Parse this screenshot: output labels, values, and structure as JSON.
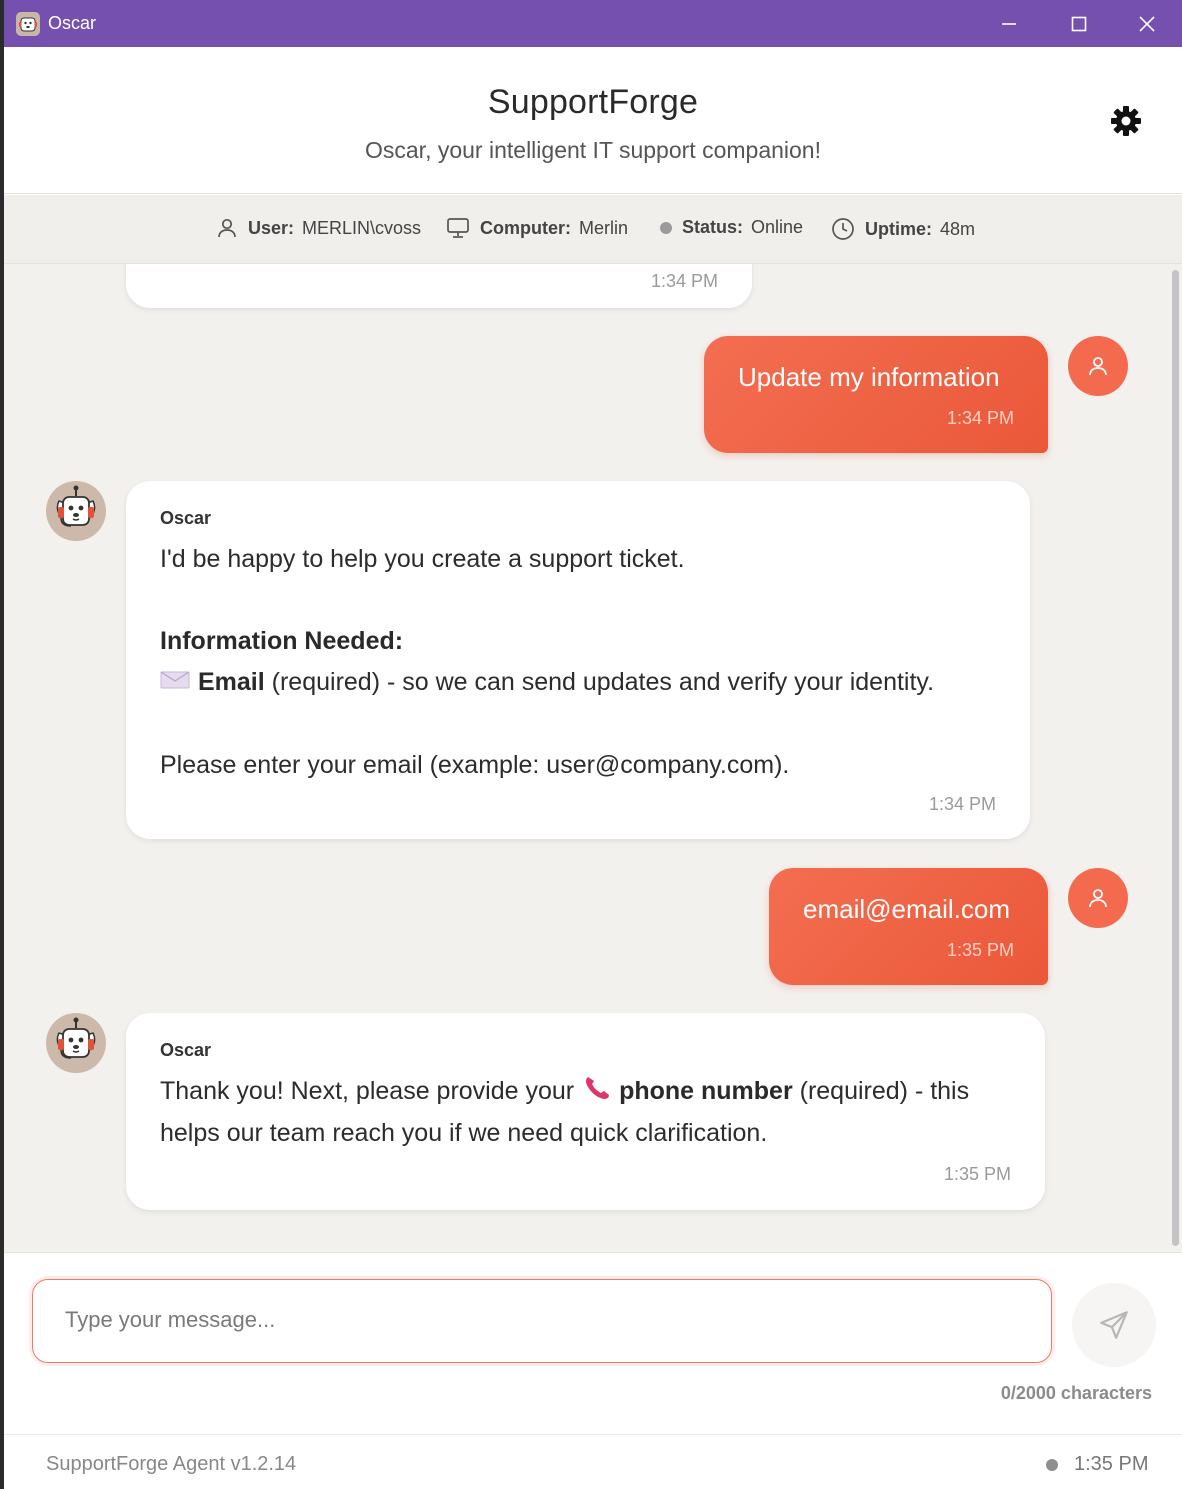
{
  "window": {
    "title": "Oscar",
    "accent": "#7650ae",
    "controls": [
      "minimize-icon",
      "maximize-icon",
      "close-icon"
    ]
  },
  "header": {
    "brand": "SupportForge",
    "tagline": "Oscar, your intelligent IT support companion!",
    "settings_icon": "gear-icon"
  },
  "info": {
    "user_label": "User:",
    "user_value": "MERLIN\\cvoss",
    "computer_label": "Computer:",
    "computer_value": "Merlin",
    "status_label": "Status:",
    "status_value": "Online",
    "uptime_label": "Uptime:",
    "uptime_value": "48m"
  },
  "messages": [
    {
      "from": "bot",
      "time": "1:34 PM"
    },
    {
      "from": "user",
      "text": "Update my information",
      "time": "1:34 PM"
    },
    {
      "from": "bot",
      "sender": "Oscar",
      "line1": "I'd be happy to help you create a support ticket.",
      "heading": "Information Needed:",
      "email_bold": "Email",
      "email_rest": " (required) - so we can send updates and verify your identity.",
      "line3": "Please enter your email (example: user@company.com).",
      "time": "1:34 PM"
    },
    {
      "from": "user",
      "text": "email@email.com",
      "time": "1:35 PM"
    },
    {
      "from": "bot",
      "sender": "Oscar",
      "pre": "Thank you! Next, please provide your ",
      "bold": "phone number",
      "post": " (required) - this helps our team reach you if we need quick clarification.",
      "time": "1:35 PM"
    }
  ],
  "composer": {
    "placeholder": "Type your message...",
    "value": "",
    "char_count": "0/2000 characters",
    "send_icon": "send-icon"
  },
  "footer": {
    "version": "SupportForge Agent v1.2.14",
    "time": "1:35 PM"
  },
  "colors": {
    "user_bubble": "#f0613f",
    "status_offline_dot": "#9b9b9b"
  }
}
